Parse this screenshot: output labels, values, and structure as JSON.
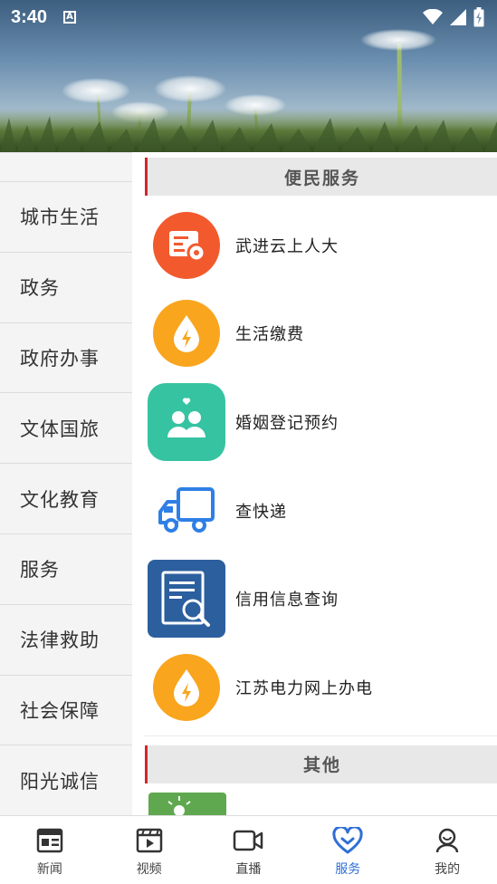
{
  "status_bar": {
    "time": "3:40",
    "notification_glyph": "A"
  },
  "sidebar": {
    "items": [
      {
        "label": "城市生活"
      },
      {
        "label": "政务"
      },
      {
        "label": "政府办事"
      },
      {
        "label": "文体国旅"
      },
      {
        "label": "文化教育"
      },
      {
        "label": "服务"
      },
      {
        "label": "法律救助"
      },
      {
        "label": "社会保障"
      },
      {
        "label": "阳光诚信"
      }
    ]
  },
  "sections": [
    {
      "title": "便民服务",
      "items": [
        {
          "label": "武进云上人大",
          "icon": "document-card-icon",
          "color": "#f25a2e"
        },
        {
          "label": "生活缴费",
          "icon": "water-drop-bolt-icon",
          "color": "#f9a51e"
        },
        {
          "label": "婚姻登记预约",
          "icon": "couple-heart-icon",
          "color": "#36c3a2"
        },
        {
          "label": "查快递",
          "icon": "delivery-truck-icon",
          "color": "#2e7fe6"
        },
        {
          "label": "信用信息查询",
          "icon": "document-search-icon",
          "color": "#2c5f9e"
        },
        {
          "label": "江苏电力网上办电",
          "icon": "water-drop-bolt-icon",
          "color": "#f9a51e"
        }
      ]
    },
    {
      "title": "其他"
    }
  ],
  "tabbar": {
    "tabs": [
      {
        "label": "新闻",
        "icon": "newspaper-icon"
      },
      {
        "label": "视频",
        "icon": "video-play-icon"
      },
      {
        "label": "直播",
        "icon": "live-camera-icon"
      },
      {
        "label": "服务",
        "icon": "heart-service-icon",
        "active": true
      },
      {
        "label": "我的",
        "icon": "user-profile-icon"
      }
    ],
    "active_color": "#2f6fd6"
  }
}
